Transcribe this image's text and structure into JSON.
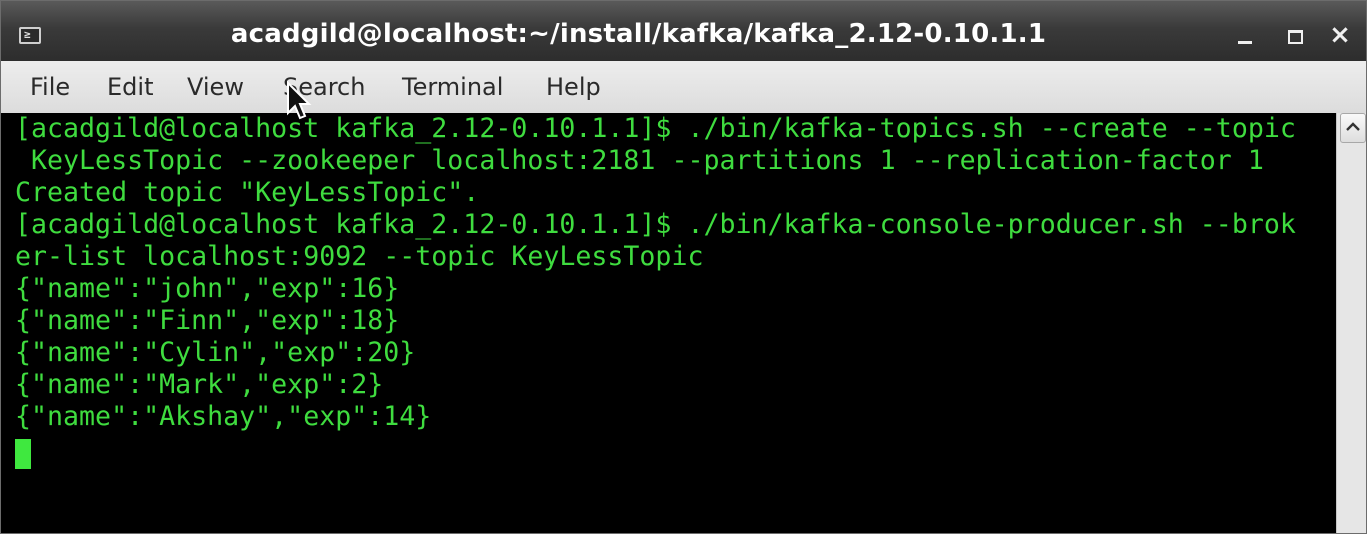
{
  "window": {
    "title": "acadgild@localhost:~/install/kafka/kafka_2.12-0.10.1.1",
    "app_icon_glyph": "≥"
  },
  "menu": {
    "file": "File",
    "edit": "Edit",
    "view": "View",
    "search": "Search",
    "terminal": "Terminal",
    "help": "Help"
  },
  "terminal": {
    "lines": [
      "[acadgild@localhost kafka_2.12-0.10.1.1]$ ./bin/kafka-topics.sh --create --topic",
      " KeyLessTopic --zookeeper localhost:2181 --partitions 1 --replication-factor 1",
      "Created topic \"KeyLessTopic\".",
      "[acadgild@localhost kafka_2.12-0.10.1.1]$ ./bin/kafka-console-producer.sh --brok",
      "er-list localhost:9092 --topic KeyLessTopic",
      "{\"name\":\"john\",\"exp\":16}",
      "{\"name\":\"Finn\",\"exp\":18}",
      "{\"name\":\"Cylin\",\"exp\":20}",
      "{\"name\":\"Mark\",\"exp\":2}",
      "{\"name\":\"Akshay\",\"exp\":14}"
    ],
    "text_color": "#3fdc3f",
    "background": "#000000"
  },
  "icons": {
    "minimize": "minimize-icon",
    "maximize": "maximize-icon",
    "close": "close-icon",
    "scroll_up": "scroll-up-arrow-icon",
    "pointer": "mouse-pointer-icon"
  }
}
